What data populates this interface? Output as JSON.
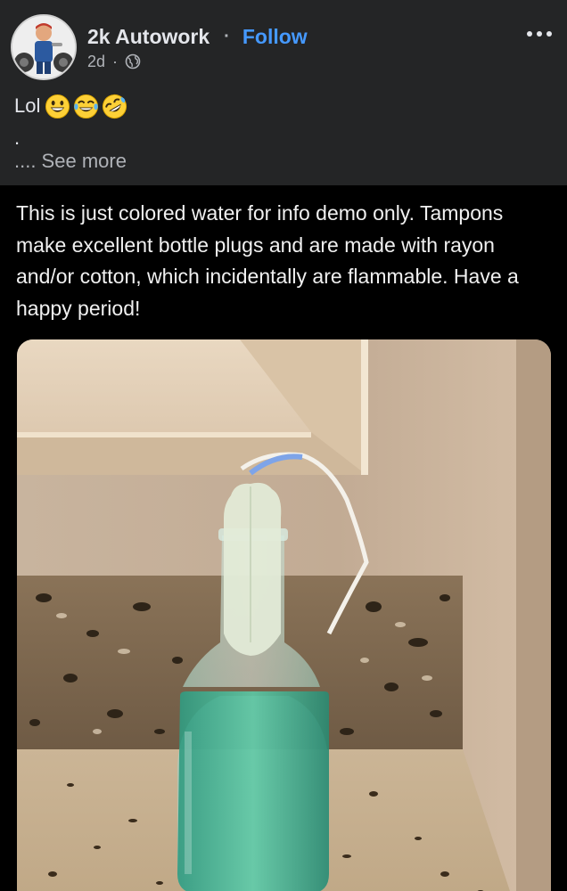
{
  "post": {
    "author": "2k Autowork",
    "separator": "·",
    "follow_label": "Follow",
    "age": "2d",
    "meta_dot": "·",
    "more_icon": "more-horizontal-icon",
    "audience_icon": "globe-icon",
    "caption": "Lol",
    "caption_emojis": [
      "grinning-face-icon",
      "face-with-tears-of-joy-icon",
      "rolling-on-floor-laughing-icon"
    ],
    "caption_second_line": ".",
    "see_more": ".... See more"
  },
  "content": {
    "text": "This is just colored water for info demo only. Tampons make excellent bottle plugs and are made with rayon and/or cotton, which incidentally are flammable. Have a happy period!"
  },
  "colors": {
    "background": "#242526",
    "content_background": "#000000",
    "link": "#4599ff",
    "primary_text": "#e4e6eb",
    "secondary_text": "#b0b3b8"
  }
}
